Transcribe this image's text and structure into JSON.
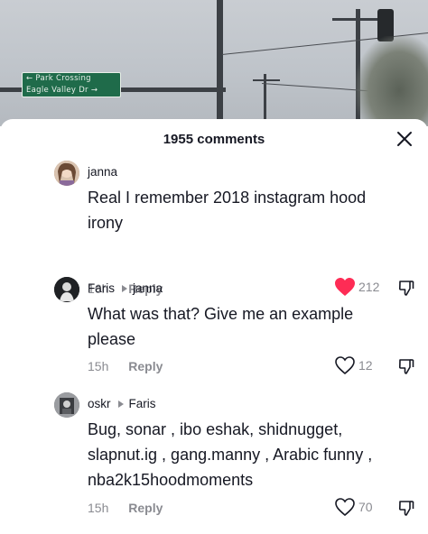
{
  "background": {
    "sign_line1": "← Park Crossing",
    "sign_line2": "Eagle Valley Dr →"
  },
  "header": {
    "comment_count": "1955 comments",
    "close_icon": "close-icon"
  },
  "comments": [
    {
      "username": "janna",
      "reply_to": "",
      "text": "Real I remember 2018 instagram hood irony",
      "time": "16h",
      "reply_label": "Reply",
      "likes": "212",
      "liked": true,
      "avatar_color": "#b98b6e"
    },
    {
      "username": "Faris",
      "reply_to": "janna",
      "text": "What was that? Give me an example please",
      "time": "15h",
      "reply_label": "Reply",
      "likes": "12",
      "liked": false,
      "avatar_color": "#2b2d31"
    },
    {
      "username": "oskr",
      "reply_to": "Faris",
      "text": "Bug, sonar , ibo eshak, shidnugget, slapnut.ig , gang.manny , Arabic funny , nba2k15hoodmoments",
      "time": "15h",
      "reply_label": "Reply",
      "likes": "70",
      "liked": false,
      "avatar_color": "#6f7175"
    }
  ],
  "colors": {
    "like_active": "#fe2c55",
    "muted": "#8a8b91",
    "text": "#161823"
  }
}
